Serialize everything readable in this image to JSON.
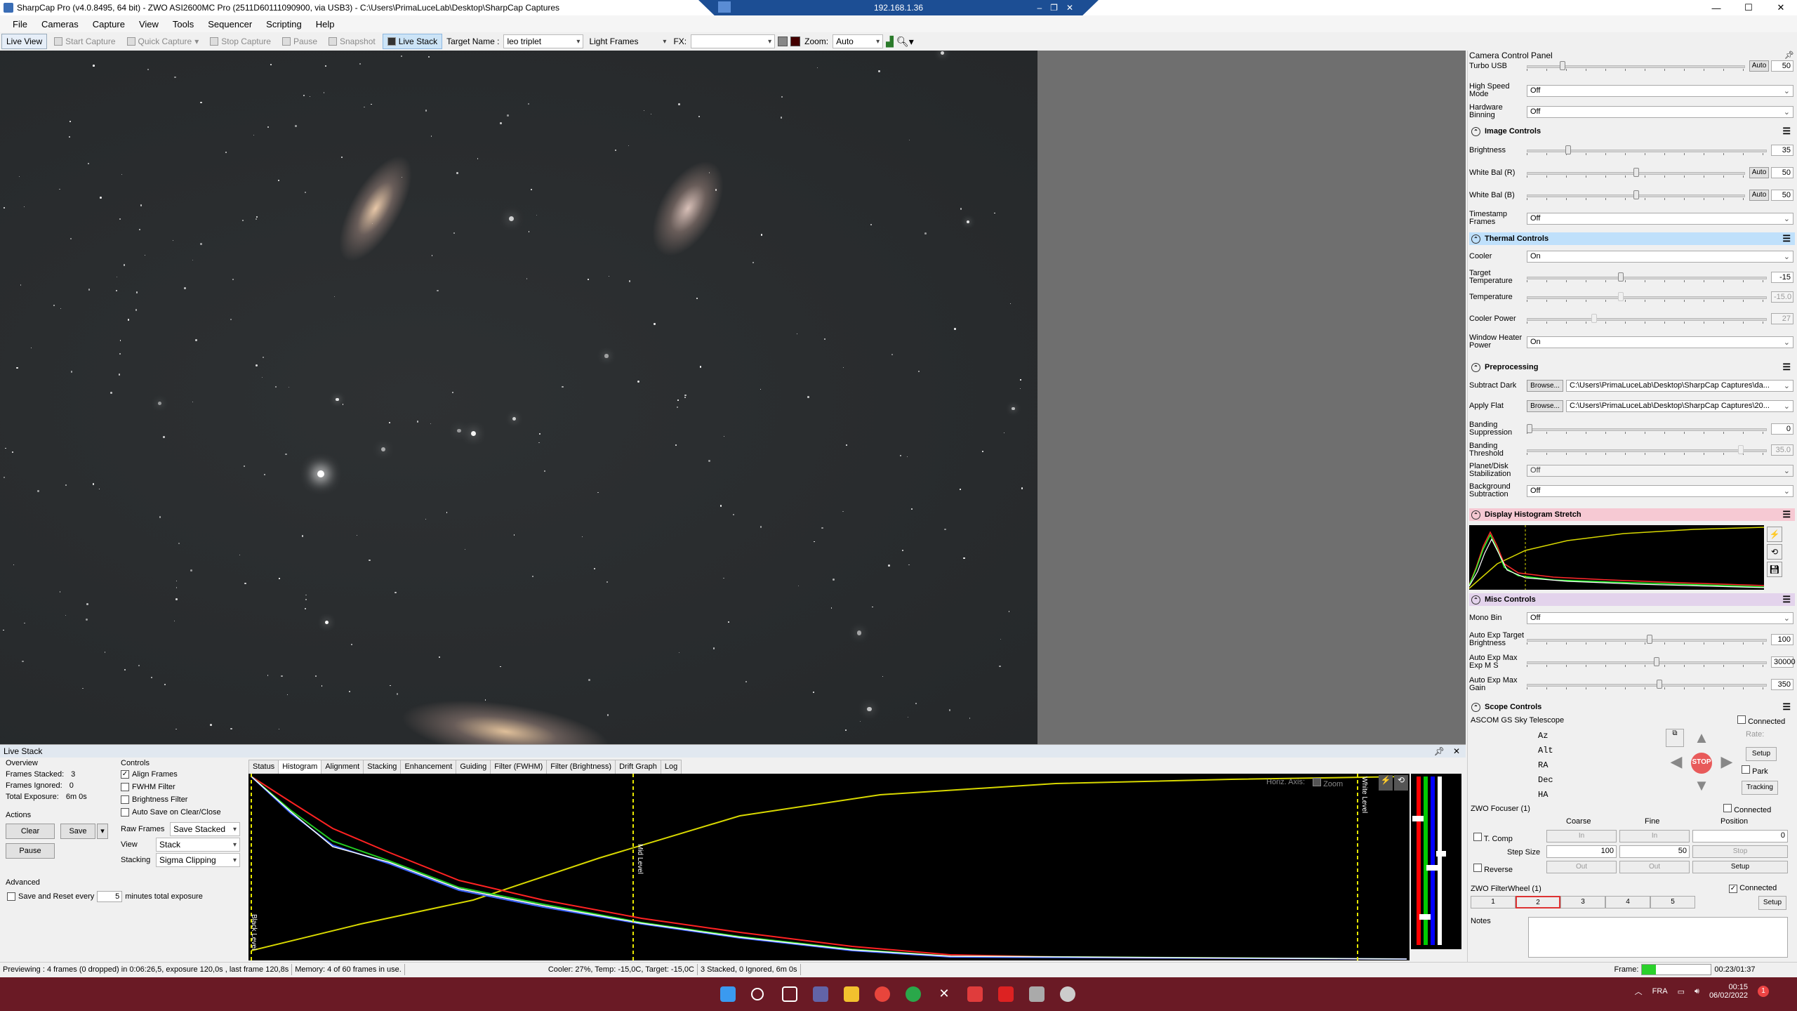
{
  "window": {
    "title": "SharpCap Pro (v4.0.8495, 64 bit) - ZWO ASI2600MC Pro (2511D60111090900, via USB3) - C:\\Users\\PrimaLuceLab\\Desktop\\SharpCap Captures",
    "remote_ip": "192.168.1.36"
  },
  "menu": [
    "File",
    "Cameras",
    "Capture",
    "View",
    "Tools",
    "Sequencer",
    "Scripting",
    "Help"
  ],
  "toolbar": {
    "live_view": "Live View",
    "start_capture": "Start Capture",
    "quick_capture": "Quick Capture",
    "stop_capture": "Stop Capture",
    "pause": "Pause",
    "snapshot": "Snapshot",
    "live_stack": "Live Stack",
    "target_label": "Target Name :",
    "target_value": "leo triplet",
    "frame_type": "Light Frames",
    "fx_label": "FX:",
    "zoom_label": "Zoom:",
    "zoom_value": "Auto"
  },
  "panel": {
    "title": "Camera Control Panel",
    "turbo_usb": {
      "label": "Turbo USB",
      "value": "50",
      "auto": "Auto"
    },
    "high_speed": {
      "label": "High Speed Mode",
      "value": "Off"
    },
    "hw_binning": {
      "label": "Hardware Binning",
      "value": "Off"
    },
    "image_controls": "Image Controls",
    "brightness": {
      "label": "Brightness",
      "value": "35"
    },
    "wb_r": {
      "label": "White Bal (R)",
      "value": "50",
      "auto": "Auto"
    },
    "wb_b": {
      "label": "White Bal (B)",
      "value": "50",
      "auto": "Auto"
    },
    "timestamp": {
      "label": "Timestamp Frames",
      "value": "Off"
    },
    "thermal": "Thermal Controls",
    "cooler": {
      "label": "Cooler",
      "value": "On"
    },
    "target_temp": {
      "label": "Target Temperature",
      "value": "-15"
    },
    "temperature": {
      "label": "Temperature",
      "value": "-15.0"
    },
    "cooler_power": {
      "label": "Cooler Power",
      "value": "27"
    },
    "window_heater": {
      "label": "Window Heater Power",
      "value": "On"
    },
    "preprocessing": "Preprocessing",
    "subtract_dark": {
      "label": "Subtract Dark",
      "browse": "Browse...",
      "value": "C:\\Users\\PrimaLuceLab\\Desktop\\SharpCap Captures\\da..."
    },
    "apply_flat": {
      "label": "Apply Flat",
      "browse": "Browse...",
      "value": "C:\\Users\\PrimaLuceLab\\Desktop\\SharpCap Captures\\20..."
    },
    "banding_supp": {
      "label": "Banding Suppression",
      "value": "0"
    },
    "banding_thr": {
      "label": "Banding Threshold",
      "value": "35.0"
    },
    "planet_stab": {
      "label": "Planet/Disk Stabilization",
      "value": "Off"
    },
    "bg_sub": {
      "label": "Background Subtraction",
      "value": "Off"
    },
    "display_histo": "Display Histogram Stretch",
    "misc": "Misc Controls",
    "mono_bin": {
      "label": "Mono Bin",
      "value": "Off"
    },
    "ae_target": {
      "label": "Auto Exp Target Brightness",
      "value": "100"
    },
    "ae_max_exp": {
      "label": "Auto Exp Max Exp M S",
      "value": "30000"
    },
    "ae_max_gain": {
      "label": "Auto Exp Max Gain",
      "value": "350"
    },
    "scope": "Scope Controls",
    "telescope": "ASCOM GS Sky Telescope",
    "connected": "Connected",
    "az": "Az",
    "alt": "Alt",
    "ra": "RA",
    "dec": "Dec",
    "ha": "HA",
    "rate": "Rate:",
    "setup": "Setup",
    "park": "Park",
    "tracking": "Tracking",
    "stop": "STOP",
    "focuser": "ZWO Focuser (1)",
    "coarse": "Coarse",
    "fine": "Fine",
    "position": "Position",
    "tcomp": "T. Comp",
    "in": "In",
    "out": "Out",
    "pos_value": "0",
    "step_size": "Step Size",
    "coarse_step": "100",
    "fine_step": "50",
    "stopbtn": "Stop",
    "reverse": "Reverse",
    "filterwheel": "ZWO FilterWheel (1)",
    "filters": [
      "1",
      "2",
      "3",
      "4",
      "5"
    ],
    "notes": "Notes"
  },
  "livestack": {
    "title": "Live Stack",
    "overview": "Overview",
    "frames_stacked": "Frames Stacked:",
    "frames_stacked_v": "3",
    "frames_ignored": "Frames Ignored:",
    "frames_ignored_v": "0",
    "total_exposure": "Total Exposure:",
    "total_exposure_v": "6m 0s",
    "actions": "Actions",
    "clear": "Clear",
    "save": "Save",
    "pause": "Pause",
    "advanced": "Advanced",
    "save_reset": "Save and Reset every",
    "save_reset_v": "5",
    "minutes": "minutes total exposure",
    "controls": "Controls",
    "align": "Align Frames",
    "fwhm": "FWHM Filter",
    "brightness_filter": "Brightness Filter",
    "autosave": "Auto Save on Clear/Close",
    "raw_frames": "Raw Frames",
    "raw_frames_v": "Save Stacked",
    "view": "View",
    "view_v": "Stack",
    "stacking": "Stacking",
    "stacking_v": "Sigma Clipping",
    "tabs": [
      "Status",
      "Histogram",
      "Alignment",
      "Stacking",
      "Enhancement",
      "Guiding",
      "Filter (FWHM)",
      "Filter (Brightness)",
      "Drift Graph",
      "Log"
    ],
    "horiz_axis": "Horiz. Axis:",
    "zoom": "Zoom",
    "black_level": "Black Level",
    "mid_level": "Mid Level",
    "white_level": "White Level"
  },
  "status": {
    "preview": "Previewing : 4 frames (0 dropped) in 0:06:26,5, exposure 120,0s , last frame 120,8s",
    "memory": "Memory: 4 of 60 frames in use.",
    "cooler": "Cooler: 27%, Temp: -15,0C, Target: -15,0C",
    "stacked": "3 Stacked, 0 Ignored, 6m 0s",
    "frame": "Frame:",
    "time": "00:23/01:37"
  },
  "taskbar": {
    "lang": "FRA",
    "clock": "00:15",
    "date": "06/02/2022",
    "notif": "1"
  },
  "colors": {
    "accent": "#1a5fb4",
    "thermal": "#bfe0fb",
    "histo_section": "#f6c9d3",
    "misc_section": "#e3d3ec",
    "taskbar": "#6a1a25"
  }
}
